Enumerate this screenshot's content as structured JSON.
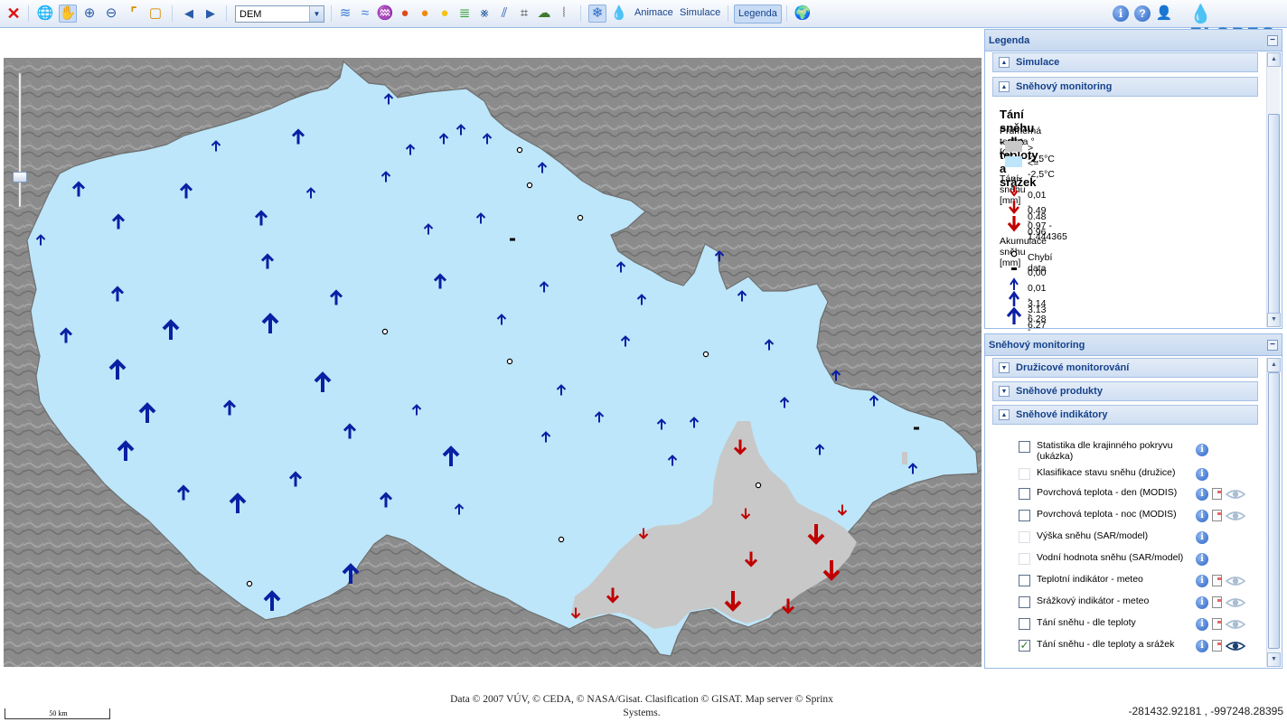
{
  "toolbar": {
    "layer_select_value": "DEM",
    "animace_label": "Animace",
    "simulace_label": "Simulace",
    "legenda_label": "Legenda",
    "logo_text": "FLOREO"
  },
  "legend_panel": {
    "title": "Legenda",
    "sections": [
      "Simulace",
      "Sněhový monitoring"
    ],
    "content_title": "Tání sněhu - dle teploty a srážek",
    "temp_heading": "Průměrná teplota °[C]",
    "temp_items": [
      {
        "label": "> -2,5°C",
        "color": "#c8c8c8"
      },
      {
        "label": "<= -2,5°C",
        "color": "#bde6fa"
      }
    ],
    "melt_heading": "Tání sněhu [mm]",
    "melt_items": [
      "0,01 - 0.48",
      "0.49 - 0.96",
      "0.97 - 1.444365"
    ],
    "accum_heading": "Akumulace sněhu [mm]",
    "accum_items": [
      "Chybí data",
      "0,00",
      "0,01 - 3.13",
      "3.14 - 6.27",
      "6.28 - 9.4"
    ],
    "melt_color": "#c00000",
    "accum_color": "#0a1fa3"
  },
  "monitoring_panel": {
    "title": "Sněhový monitoring",
    "sections": [
      "Družicové monitorování",
      "Sněhové produkty",
      "Sněhové indikátory"
    ],
    "indicators": [
      {
        "label": "Statistika dle krajinného pokryvu (ukázka)",
        "checked": false,
        "enabled": true,
        "info": true,
        "doc": false,
        "eye": false
      },
      {
        "label": "Klasifikace stavu sněhu (družice)",
        "checked": false,
        "enabled": false,
        "info": true,
        "doc": false,
        "eye": false
      },
      {
        "label": "Povrchová teplota - den (MODIS)",
        "checked": false,
        "enabled": true,
        "info": true,
        "doc": true,
        "eye": true
      },
      {
        "label": "Povrchová teplota - noc (MODIS)",
        "checked": false,
        "enabled": true,
        "info": true,
        "doc": true,
        "eye": true
      },
      {
        "label": "Výška sněhu (SAR/model)",
        "checked": false,
        "enabled": false,
        "info": true,
        "doc": false,
        "eye": false
      },
      {
        "label": "Vodní hodnota sněhu (SAR/model)",
        "checked": false,
        "enabled": false,
        "info": true,
        "doc": false,
        "eye": false
      },
      {
        "label": "Teplotní indikátor - meteo",
        "checked": false,
        "enabled": true,
        "info": true,
        "doc": true,
        "eye": true
      },
      {
        "label": "Srážkový indikátor - meteo",
        "checked": false,
        "enabled": true,
        "info": true,
        "doc": true,
        "eye": true
      },
      {
        "label": "Tání sněhu - dle teploty",
        "checked": false,
        "enabled": true,
        "info": true,
        "doc": true,
        "eye": true
      },
      {
        "label": "Tání sněhu - dle teploty a srážek",
        "checked": true,
        "enabled": true,
        "info": true,
        "doc": true,
        "eye": true
      }
    ]
  },
  "footer": {
    "attribution_line1": "Data © 2007 VÚV, © CEDA, © NASA/Gisat. Clasification © GISAT. Map server © Sprinx",
    "attribution_line2": "Systems.",
    "coordinates": "-281432.92181 , -997248.28395",
    "scale_label": "50 km"
  },
  "map": {
    "country_fill": "#bde6fa",
    "warm_fill": "#c8c8c8",
    "relief_color": "#8b8b8b"
  }
}
